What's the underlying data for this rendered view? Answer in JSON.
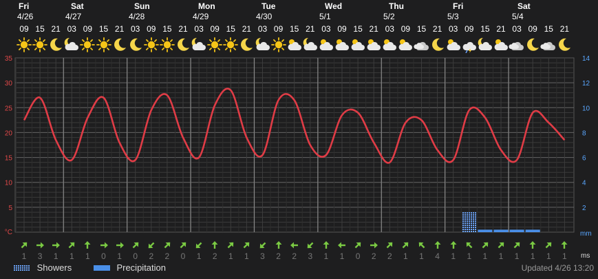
{
  "days": [
    {
      "day": "Fri",
      "date": "4/26"
    },
    {
      "day": "Sat",
      "date": "4/27"
    },
    {
      "day": "Sun",
      "date": "4/28"
    },
    {
      "day": "Mon",
      "date": "4/29"
    },
    {
      "day": "Tue",
      "date": "4/30"
    },
    {
      "day": "Wed",
      "date": "5/1"
    },
    {
      "day": "Thu",
      "date": "5/2"
    },
    {
      "day": "Fri",
      "date": "5/3"
    },
    {
      "day": "Sat",
      "date": "5/4"
    }
  ],
  "hours": [
    "09",
    "15",
    "21",
    "03",
    "09",
    "15",
    "21",
    "03",
    "09",
    "15",
    "21",
    "03",
    "09",
    "15",
    "21",
    "03",
    "09",
    "15",
    "21",
    "03",
    "09",
    "15",
    "21",
    "03",
    "09",
    "15",
    "21",
    "03",
    "09",
    "15",
    "21",
    "03",
    "09",
    "15",
    "21"
  ],
  "weather_icons": [
    "sun",
    "sun",
    "moon",
    "partly-cloudy-moon",
    "sun",
    "sun",
    "moon",
    "moon",
    "sun",
    "sun",
    "moon",
    "partly-cloudy-moon",
    "sun",
    "sun",
    "moon",
    "partly-cloudy-moon",
    "sun",
    "partly-cloudy",
    "partly-cloudy-moon",
    "partly-cloudy",
    "partly-cloudy",
    "partly-cloudy",
    "partly-cloudy",
    "partly-cloudy",
    "partly-cloudy",
    "cloudy",
    "moon",
    "partly-cloudy",
    "showers",
    "partly-cloudy-moon",
    "partly-cloudy",
    "cloudy",
    "moon",
    "cloudy",
    "moon"
  ],
  "left_axis": {
    "unit": "°C",
    "ticks": [
      35,
      30,
      25,
      20,
      15,
      10,
      5
    ]
  },
  "right_axis": {
    "unit": "mm",
    "ticks": [
      14,
      12,
      10,
      8,
      6,
      4,
      2
    ]
  },
  "wind": {
    "unit": "ms",
    "directions": [
      "sw",
      "w",
      "w",
      "sw",
      "s",
      "w",
      "w",
      "sw",
      "ne",
      "sw",
      "sw",
      "ne",
      "s",
      "sw",
      "sw",
      "ne",
      "s",
      "e",
      "ne",
      "s",
      "e",
      "sw",
      "w",
      "sw",
      "sw",
      "se",
      "s",
      "s",
      "se",
      "sw",
      "sw",
      "sw",
      "s",
      "sw",
      "s"
    ],
    "speeds": [
      1,
      3,
      1,
      1,
      1,
      0,
      1,
      0,
      2,
      2,
      0,
      1,
      2,
      1,
      1,
      3,
      2,
      2,
      3,
      1,
      1,
      0,
      2,
      2,
      1,
      1,
      4,
      1,
      1,
      1,
      1,
      1,
      1,
      1,
      1
    ]
  },
  "legend": {
    "showers": "Showers",
    "precipitation": "Precipitation"
  },
  "updated": "Updated 4/26 13:20",
  "colors": {
    "temperature": "#e03c46",
    "showers": "#6fa8ff",
    "precipitation": "#4a8fe8",
    "axis_left": "#e04848",
    "axis_right": "#5aa7ff",
    "wind": "#7ac943"
  },
  "chart_data": {
    "type": "line",
    "x": [
      "4/26 09",
      "4/26 15",
      "4/26 21",
      "4/27 03",
      "4/27 09",
      "4/27 15",
      "4/27 21",
      "4/28 03",
      "4/28 09",
      "4/28 15",
      "4/28 21",
      "4/29 03",
      "4/29 09",
      "4/29 15",
      "4/29 21",
      "4/30 03",
      "4/30 09",
      "4/30 15",
      "4/30 21",
      "5/1 03",
      "5/1 09",
      "5/1 15",
      "5/1 21",
      "5/2 03",
      "5/2 09",
      "5/2 15",
      "5/2 21",
      "5/3 03",
      "5/3 09",
      "5/3 15",
      "5/3 21",
      "5/4 03",
      "5/4 09",
      "5/4 15",
      "5/4 21"
    ],
    "temperature": [
      22.5,
      27.0,
      18.5,
      14.5,
      23.0,
      27.0,
      18.0,
      14.5,
      24.5,
      27.5,
      19.0,
      15.0,
      25.5,
      28.5,
      19.0,
      15.5,
      26.5,
      26.5,
      17.5,
      15.5,
      23.5,
      24.0,
      18.0,
      14.0,
      22.0,
      22.5,
      16.5,
      14.5,
      24.5,
      23.0,
      16.5,
      14.5,
      24.0,
      22.0,
      18.5
    ],
    "precipitation_mm": [
      0,
      0,
      0,
      0,
      0,
      0,
      0,
      0,
      0,
      0,
      0,
      0,
      0,
      0,
      0,
      0,
      0,
      0,
      0,
      0,
      0,
      0,
      0,
      0,
      0,
      0,
      0,
      0,
      1.6,
      0.2,
      0.2,
      0.2,
      0.2,
      0,
      0
    ],
    "precipitation_type": [
      "",
      "",
      "",
      "",
      "",
      "",
      "",
      "",
      "",
      "",
      "",
      "",
      "",
      "",
      "",
      "",
      "",
      "",
      "",
      "",
      "",
      "",
      "",
      "",
      "",
      "",
      "",
      "",
      "showers",
      "precipitation",
      "precipitation",
      "precipitation",
      "precipitation",
      "",
      ""
    ],
    "ylim_left": [
      0,
      35
    ],
    "ylim_right": [
      0,
      14
    ],
    "ylabel_left": "°C",
    "ylabel_right": "mm",
    "grid": true
  }
}
